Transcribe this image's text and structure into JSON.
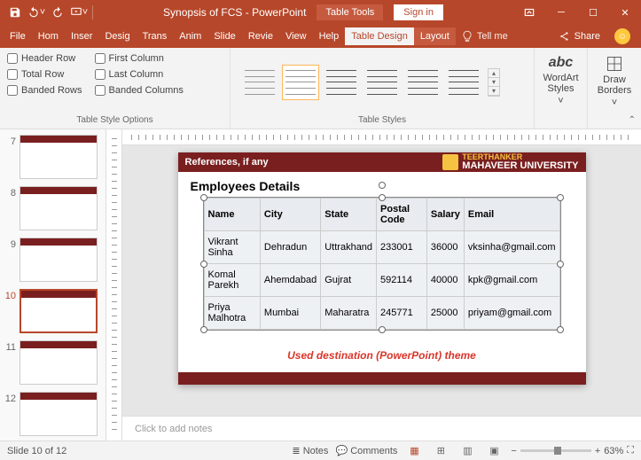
{
  "qat": {
    "save": "Save",
    "undo": "Undo",
    "redo": "Redo",
    "start": "Start From Beginning"
  },
  "title": "Synopsis of FCS  -  PowerPoint",
  "toolContext": "Table Tools",
  "signin": "Sign in",
  "tabs": {
    "file": "File",
    "home": "Hom",
    "insert": "Inser",
    "design": "Desig",
    "trans": "Trans",
    "anim": "Anim",
    "slide": "Slide",
    "review": "Revie",
    "view": "View",
    "help": "Help",
    "tdesign": "Table Design",
    "layout": "Layout"
  },
  "tellme": "Tell me",
  "share": "Share",
  "tso": {
    "header": "Header Row",
    "total": "Total Row",
    "banded_r": "Banded Rows",
    "first": "First Column",
    "last": "Last Column",
    "banded_c": "Banded Columns",
    "group": "Table Style Options"
  },
  "tstyles": {
    "group": "Table Styles"
  },
  "wordart": "WordArt Styles",
  "wordart2": " ˅",
  "drawb": "Draw Borders",
  "drawb2": " ˅",
  "thumbs": [
    "7",
    "8",
    "9",
    "10",
    "11",
    "12"
  ],
  "slide": {
    "ref": "References, if any",
    "uni1": "TEERTHANKER",
    "uni2": "MAHAVEER UNIVERSITY",
    "heading": "Employees Details",
    "cols": [
      "Name",
      "City",
      "State",
      "Postal Code",
      "Salary",
      "Email"
    ],
    "rows": [
      [
        "Vikrant Sinha",
        "Dehradun",
        "Uttrakhand",
        "233001",
        "36000",
        "vksinha@gmail.com"
      ],
      [
        "Komal Parekh",
        "Ahemdabad",
        "Gujrat",
        "592114",
        "40000",
        "kpk@gmail.com"
      ],
      [
        "Priya Malhotra",
        "Mumbai",
        "Maharatra",
        "245771",
        "25000",
        "priyam@gmail.com"
      ]
    ],
    "caption": "Used destination (PowerPoint) theme"
  },
  "notes": "Click to add notes",
  "status": {
    "slide": "Slide 10 of 12",
    "notes": "Notes",
    "comments": "Comments",
    "zoom": "63%"
  }
}
